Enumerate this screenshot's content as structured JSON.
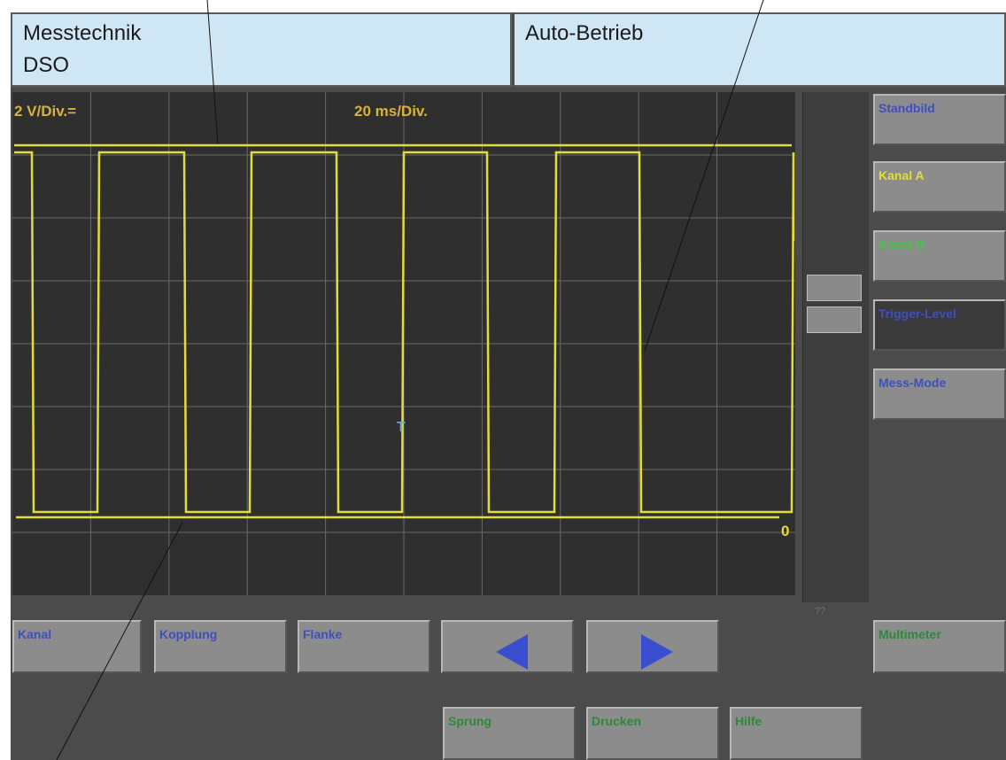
{
  "header": {
    "title": "Messtechnik",
    "subtitle": "DSO",
    "mode": "Auto-Betrieb"
  },
  "scope": {
    "volts_div": "2 V/Div.=",
    "time_div": "20 ms/Div.",
    "trigger_marker": "T",
    "zero_marker": "0"
  },
  "side_buttons": [
    "Standbild",
    "Kanal A",
    "Kanal B",
    "Trigger-Level",
    "Mess-Mode"
  ],
  "bottom_row1": [
    "Kanal",
    "Kopplung",
    "Flanke"
  ],
  "bottom_row2": [
    "Sprung",
    "Drucken",
    "Hilfe"
  ],
  "multimeter": "Multimeter",
  "track_label": "??",
  "colors": {
    "trace": "#e2dd3a",
    "header_bg": "#cfe6f5",
    "screen_bg": "#2f2f2f",
    "grid": "#6a6a6a",
    "button": "#8c8c8c",
    "label_blue": "#3f4fbf",
    "label_yellow": "#e2dd3a",
    "label_green": "#49c24a"
  },
  "icons": [
    "arrow-left-icon",
    "arrow-right-icon"
  ]
}
